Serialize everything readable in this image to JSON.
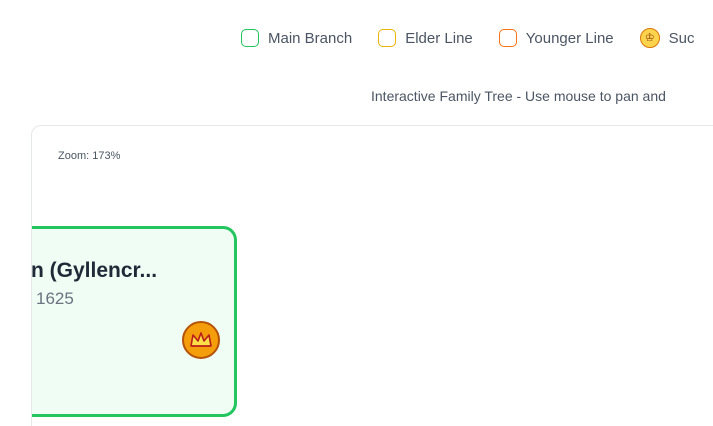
{
  "legend": {
    "items": [
      {
        "label": "Main Branch",
        "color": "#22c55e",
        "icon": "square-outline-icon"
      },
      {
        "label": "Elder Line",
        "color": "#eab308",
        "icon": "square-outline-icon"
      },
      {
        "label": "Younger Line",
        "color": "#f97316",
        "icon": "square-outline-icon"
      },
      {
        "label": "Suc",
        "color": "#f59e0b",
        "icon": "crown-icon"
      }
    ]
  },
  "instructions": "Interactive Family Tree - Use mouse to pan and",
  "canvas": {
    "zoom_label": "Zoom: 173%"
  },
  "person": {
    "name": "n (Gyllencr...",
    "dates": "1625",
    "branch_color": "#22c55e",
    "badge_icon": "crown-icon"
  }
}
